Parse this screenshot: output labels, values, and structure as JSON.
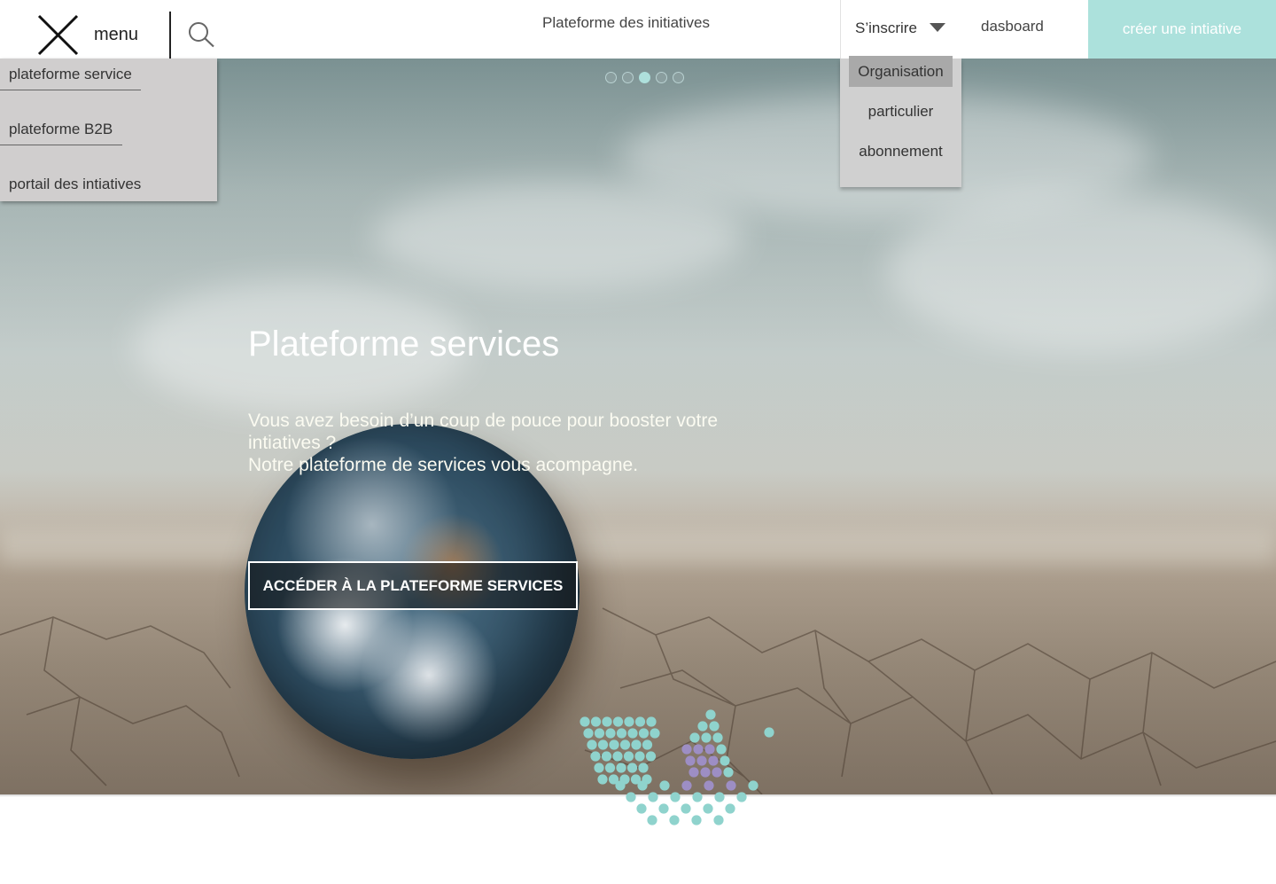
{
  "header": {
    "menu_label": "menu",
    "site_title": "Plateforme des initiatives",
    "signup_label": "S’inscrire",
    "dashboard_label": "dasboard",
    "create_label": "créer une intiative",
    "icons": {
      "close": "close-icon",
      "search": "search-icon",
      "caret": "caret-down-icon"
    }
  },
  "signup_dropdown": {
    "items": [
      {
        "label": "Organisation",
        "highlighted": true
      },
      {
        "label": "particulier",
        "highlighted": false
      },
      {
        "label": "abonnement",
        "highlighted": false
      }
    ]
  },
  "side_menu": {
    "items": [
      {
        "label": "plateforme service"
      },
      {
        "label": "plateforme B2B"
      },
      {
        "label": "portail des intiatives"
      }
    ]
  },
  "hero": {
    "title": "Plateforme services",
    "text_line1": "Vous avez besoin d’un coup de pouce pour booster votre intiatives ?",
    "text_line2": "Notre plateforme de services vous acompagne.",
    "cta_label": "ACCÉDER À LA PLATEFORME SERVICES",
    "slides_total": 5,
    "active_slide": 3
  },
  "colors": {
    "accent": "#ace1dc",
    "dropdown_bg": "#d0d0d0",
    "dropdown_highlight": "#a9a9a9",
    "logo_teal": "#8fd3cd",
    "logo_purple": "#9d8ec4"
  }
}
